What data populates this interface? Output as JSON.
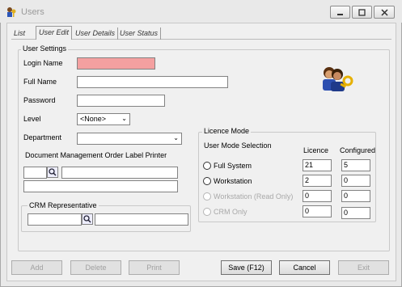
{
  "window": {
    "title": "Users"
  },
  "tabs": [
    "List",
    "User Edit",
    "User Details",
    "User Status"
  ],
  "user_settings": {
    "group_label": "User Settings",
    "login_name_label": "Login Name",
    "login_name_value": "",
    "full_name_label": "Full Name",
    "full_name_value": "",
    "password_label": "Password",
    "password_value": "",
    "level_label": "Level",
    "level_value": "<None>",
    "department_label": "Department",
    "department_value": "",
    "doc_printer_label": "Document Management Order Label Printer",
    "crm_label": "CRM Representative"
  },
  "licence_mode": {
    "group_label": "Licence Mode",
    "selection_label": "User Mode Selection",
    "licence_header": "Licence",
    "configured_header": "Configured",
    "rows": [
      {
        "label": "Full System",
        "licence": "21",
        "configured": "5",
        "enabled": true
      },
      {
        "label": "Workstation",
        "licence": "2",
        "configured": "0",
        "enabled": true
      },
      {
        "label": "Workstation (Read Only)",
        "licence": "0",
        "configured": "0",
        "enabled": false
      },
      {
        "label": "CRM Only",
        "licence": "0",
        "configured": "0",
        "enabled": false
      }
    ]
  },
  "buttons": {
    "add": "Add",
    "delete": "Delete",
    "print": "Print",
    "save": "Save (F12)",
    "cancel": "Cancel",
    "exit": "Exit"
  },
  "colors": {
    "login_highlight": "#f4a0a0",
    "disabled_text": "#a8a8a8"
  },
  "icons": {
    "app": "users-keys-icon",
    "header_image": "users-with-key-icon",
    "lookup": "magnifier-icon"
  }
}
